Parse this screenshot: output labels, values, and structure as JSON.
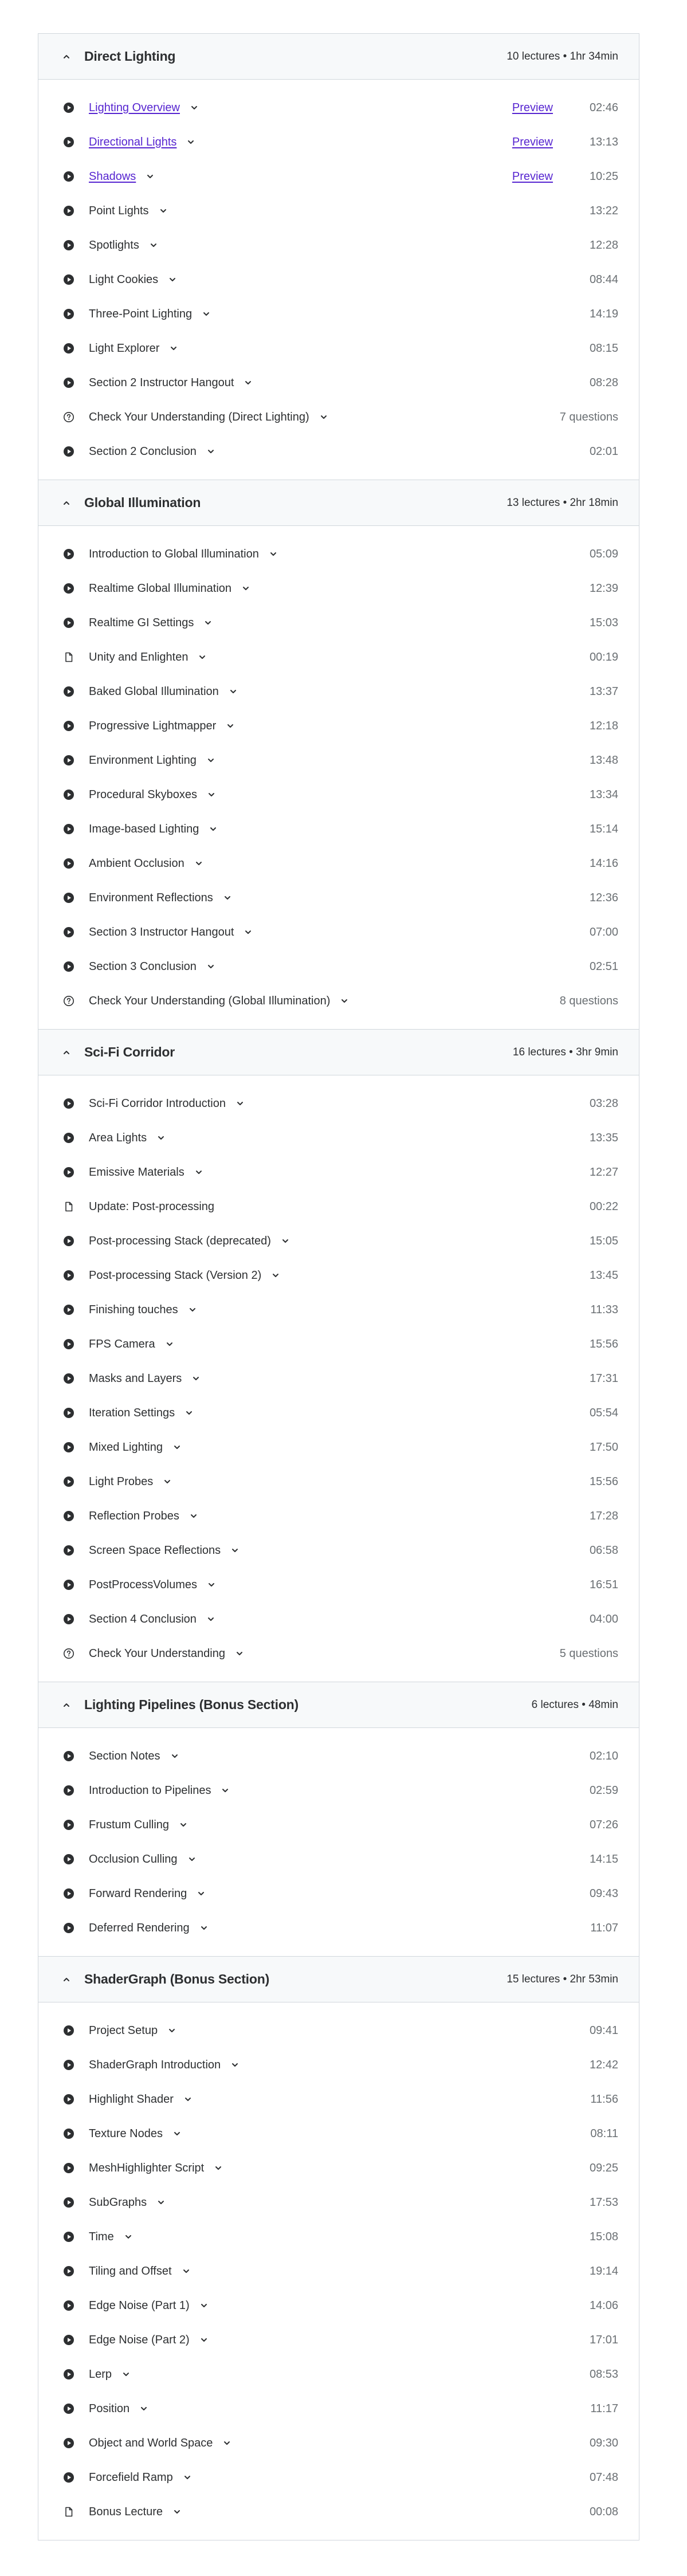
{
  "colors": {
    "link": "#5624d0",
    "header_bg": "#f7f9fa",
    "border": "#d1d7dc",
    "text": "#2d2f31",
    "muted": "#6a6f73"
  },
  "sections": [
    {
      "title": "Direct Lighting",
      "meta": "10 lectures • 1hr 34min",
      "lectures": [
        {
          "icon": "play",
          "title": "Lighting Overview",
          "link": true,
          "preview": "Preview",
          "duration": "02:46"
        },
        {
          "icon": "play",
          "title": "Directional Lights",
          "link": true,
          "preview": "Preview",
          "duration": "13:13"
        },
        {
          "icon": "play",
          "title": "Shadows",
          "link": true,
          "preview": "Preview",
          "duration": "10:25"
        },
        {
          "icon": "play",
          "title": "Point Lights",
          "duration": "13:22"
        },
        {
          "icon": "play",
          "title": "Spotlights",
          "duration": "12:28"
        },
        {
          "icon": "play",
          "title": "Light Cookies",
          "duration": "08:44"
        },
        {
          "icon": "play",
          "title": "Three-Point Lighting",
          "duration": "14:19"
        },
        {
          "icon": "play",
          "title": "Light Explorer",
          "duration": "08:15"
        },
        {
          "icon": "play",
          "title": "Section 2 Instructor Hangout",
          "duration": "08:28"
        },
        {
          "icon": "quiz",
          "title": "Check Your Understanding (Direct Lighting)",
          "duration": "7 questions"
        },
        {
          "icon": "play",
          "title": "Section 2 Conclusion",
          "duration": "02:01"
        }
      ]
    },
    {
      "title": "Global Illumination",
      "meta": "13 lectures • 2hr 18min",
      "lectures": [
        {
          "icon": "play",
          "title": "Introduction to Global Illumination",
          "duration": "05:09"
        },
        {
          "icon": "play",
          "title": "Realtime Global Illumination",
          "duration": "12:39"
        },
        {
          "icon": "play",
          "title": "Realtime GI Settings",
          "duration": "15:03"
        },
        {
          "icon": "file",
          "title": "Unity and Enlighten",
          "duration": "00:19"
        },
        {
          "icon": "play",
          "title": "Baked Global Illumination",
          "duration": "13:37"
        },
        {
          "icon": "play",
          "title": "Progressive Lightmapper",
          "duration": "12:18"
        },
        {
          "icon": "play",
          "title": "Environment Lighting",
          "duration": "13:48"
        },
        {
          "icon": "play",
          "title": "Procedural Skyboxes",
          "duration": "13:34"
        },
        {
          "icon": "play",
          "title": "Image-based Lighting",
          "duration": "15:14"
        },
        {
          "icon": "play",
          "title": "Ambient Occlusion",
          "duration": "14:16"
        },
        {
          "icon": "play",
          "title": "Environment Reflections",
          "duration": "12:36"
        },
        {
          "icon": "play",
          "title": "Section 3 Instructor Hangout",
          "duration": "07:00"
        },
        {
          "icon": "play",
          "title": "Section 3 Conclusion",
          "duration": "02:51"
        },
        {
          "icon": "quiz",
          "title": "Check Your Understanding (Global Illumination)",
          "duration": "8 questions"
        }
      ]
    },
    {
      "title": "Sci-Fi Corridor",
      "meta": "16 lectures • 3hr 9min",
      "lectures": [
        {
          "icon": "play",
          "title": "Sci-Fi Corridor Introduction",
          "duration": "03:28"
        },
        {
          "icon": "play",
          "title": "Area Lights",
          "duration": "13:35"
        },
        {
          "icon": "play",
          "title": "Emissive Materials",
          "duration": "12:27"
        },
        {
          "icon": "file",
          "title": "Update: Post-processing",
          "nochev": true,
          "duration": "00:22"
        },
        {
          "icon": "play",
          "title": "Post-processing Stack (deprecated)",
          "duration": "15:05"
        },
        {
          "icon": "play",
          "title": "Post-processing Stack (Version 2)",
          "duration": "13:45"
        },
        {
          "icon": "play",
          "title": "Finishing touches",
          "duration": "11:33"
        },
        {
          "icon": "play",
          "title": "FPS Camera",
          "duration": "15:56"
        },
        {
          "icon": "play",
          "title": "Masks and Layers",
          "duration": "17:31"
        },
        {
          "icon": "play",
          "title": "Iteration Settings",
          "duration": "05:54"
        },
        {
          "icon": "play",
          "title": "Mixed Lighting",
          "duration": "17:50"
        },
        {
          "icon": "play",
          "title": "Light Probes",
          "duration": "15:56"
        },
        {
          "icon": "play",
          "title": "Reflection Probes",
          "duration": "17:28"
        },
        {
          "icon": "play",
          "title": "Screen Space Reflections",
          "duration": "06:58"
        },
        {
          "icon": "play",
          "title": "PostProcessVolumes",
          "duration": "16:51"
        },
        {
          "icon": "play",
          "title": "Section 4 Conclusion",
          "duration": "04:00"
        },
        {
          "icon": "quiz",
          "title": "Check Your Understanding",
          "duration": "5 questions"
        }
      ]
    },
    {
      "title": "Lighting Pipelines (Bonus Section)",
      "meta": "6 lectures • 48min",
      "lectures": [
        {
          "icon": "play",
          "title": "Section Notes",
          "duration": "02:10"
        },
        {
          "icon": "play",
          "title": "Introduction to Pipelines",
          "duration": "02:59"
        },
        {
          "icon": "play",
          "title": "Frustum Culling",
          "duration": "07:26"
        },
        {
          "icon": "play",
          "title": "Occlusion Culling",
          "duration": "14:15"
        },
        {
          "icon": "play",
          "title": "Forward Rendering",
          "duration": "09:43"
        },
        {
          "icon": "play",
          "title": "Deferred Rendering",
          "duration": "11:07"
        }
      ]
    },
    {
      "title": "ShaderGraph (Bonus Section)",
      "meta": "15 lectures • 2hr 53min",
      "lectures": [
        {
          "icon": "play",
          "title": "Project Setup",
          "duration": "09:41"
        },
        {
          "icon": "play",
          "title": "ShaderGraph Introduction",
          "duration": "12:42"
        },
        {
          "icon": "play",
          "title": "Highlight Shader",
          "duration": "11:56"
        },
        {
          "icon": "play",
          "title": "Texture Nodes",
          "duration": "08:11"
        },
        {
          "icon": "play",
          "title": "MeshHighlighter Script",
          "duration": "09:25"
        },
        {
          "icon": "play",
          "title": "SubGraphs",
          "duration": "17:53"
        },
        {
          "icon": "play",
          "title": "Time",
          "duration": "15:08"
        },
        {
          "icon": "play",
          "title": "Tiling and Offset",
          "duration": "19:14"
        },
        {
          "icon": "play",
          "title": "Edge Noise (Part 1)",
          "duration": "14:06"
        },
        {
          "icon": "play",
          "title": "Edge Noise (Part 2)",
          "duration": "17:01"
        },
        {
          "icon": "play",
          "title": "Lerp",
          "duration": "08:53"
        },
        {
          "icon": "play",
          "title": "Position",
          "duration": "11:17"
        },
        {
          "icon": "play",
          "title": "Object and World Space",
          "duration": "09:30"
        },
        {
          "icon": "play",
          "title": "Forcefield Ramp",
          "duration": "07:48"
        },
        {
          "icon": "file",
          "title": "Bonus Lecture",
          "duration": "00:08"
        }
      ]
    }
  ]
}
